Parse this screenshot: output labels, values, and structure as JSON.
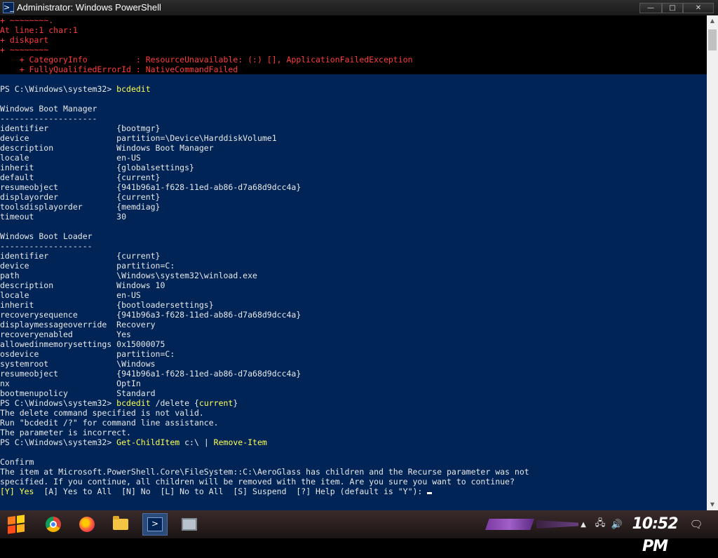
{
  "window": {
    "title": "Administrator: Windows PowerShell",
    "app_icon": ">_",
    "minimize": "—",
    "maximize": "□",
    "close": "✕"
  },
  "console": {
    "error_lines": [
      "+ ~~~~~~~~.",
      "At line:1 char:1",
      "+ diskpart",
      "+ ~~~~~~~~",
      "    + CategoryInfo          : ResourceUnavailable: (:) [], ApplicationFailedException",
      "    + FullyQualifiedErrorId : NativeCommandFailed"
    ],
    "prompt": "PS C:\\Windows\\system32> ",
    "cmd1": "bcdedit",
    "boot_manager": {
      "heading": "Windows Boot Manager",
      "underline": "--------------------",
      "rows": [
        [
          "identifier",
          "{bootmgr}"
        ],
        [
          "device",
          "partition=\\Device\\HarddiskVolume1"
        ],
        [
          "description",
          "Windows Boot Manager"
        ],
        [
          "locale",
          "en-US"
        ],
        [
          "inherit",
          "{globalsettings}"
        ],
        [
          "default",
          "{current}"
        ],
        [
          "resumeobject",
          "{941b96a1-f628-11ed-ab86-d7a68d9dcc4a}"
        ],
        [
          "displayorder",
          "{current}"
        ],
        [
          "toolsdisplayorder",
          "{memdiag}"
        ],
        [
          "timeout",
          "30"
        ]
      ]
    },
    "boot_loader": {
      "heading": "Windows Boot Loader",
      "underline": "-------------------",
      "rows": [
        [
          "identifier",
          "{current}"
        ],
        [
          "device",
          "partition=C:"
        ],
        [
          "path",
          "\\Windows\\system32\\winload.exe"
        ],
        [
          "description",
          "Windows 10"
        ],
        [
          "locale",
          "en-US"
        ],
        [
          "inherit",
          "{bootloadersettings}"
        ],
        [
          "recoverysequence",
          "{941b96a3-f628-11ed-ab86-d7a68d9dcc4a}"
        ],
        [
          "displaymessageoverride",
          "Recovery"
        ],
        [
          "recoveryenabled",
          "Yes"
        ],
        [
          "allowedinmemorysettings",
          "0x15000075"
        ],
        [
          "osdevice",
          "partition=C:"
        ],
        [
          "systemroot",
          "\\Windows"
        ],
        [
          "resumeobject",
          "{941b96a1-f628-11ed-ab86-d7a68d9dcc4a}"
        ],
        [
          "nx",
          "OptIn"
        ],
        [
          "bootmenupolicy",
          "Standard"
        ]
      ]
    },
    "cmd2": {
      "name": "bcdedit",
      "args": " /delete {",
      "arg_highlight": "current",
      "args_end": "}"
    },
    "cmd2_output": [
      "The delete command specified is not valid.",
      "Run \"bcdedit /?\" for command line assistance.",
      "The parameter is incorrect."
    ],
    "cmd3": {
      "name": "Get-ChildItem",
      "arg": " c:\\ ",
      "pipe": "|",
      "name2": " Remove-Item"
    },
    "confirm": {
      "heading": "Confirm",
      "line1": "The item at Microsoft.PowerShell.Core\\FileSystem::C:\\AeroGlass has children and the Recurse parameter was not",
      "line2": "specified. If you continue, all children will be removed with the item. Are you sure you want to continue?",
      "option_yes": "[Y] Yes",
      "options_rest": "  [A] Yes to All  [N] No  [L] No to All  [S] Suspend  [?] Help (default is \"Y\"): "
    }
  },
  "taskbar": {
    "clock": "10:52 PM",
    "items": [
      "start",
      "chrome",
      "firefox",
      "file-explorer",
      "powershell",
      "monitor"
    ]
  }
}
